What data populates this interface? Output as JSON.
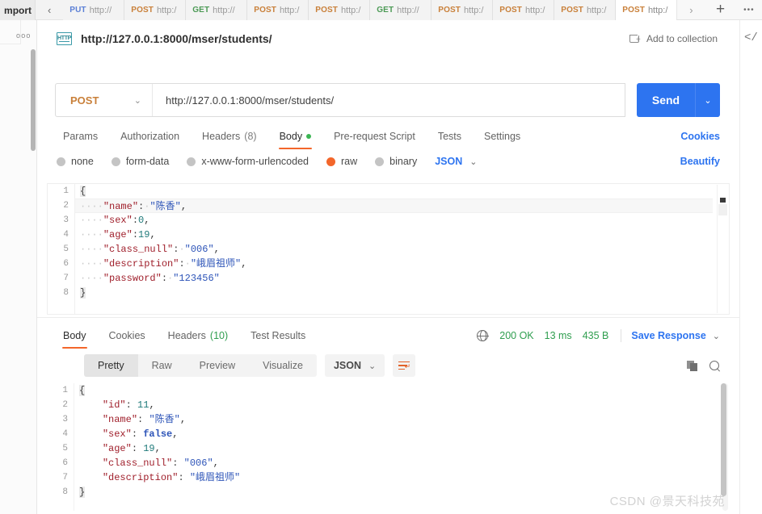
{
  "app": {
    "import_label": "mport",
    "watermark": "CSDN @景天科技苑"
  },
  "tabbar": {
    "left_chevron": "‹",
    "right_chevron": "›",
    "plus": "+",
    "dots": "•••",
    "tabs": [
      {
        "method": "PUT",
        "url": "http://",
        "active": false
      },
      {
        "method": "POST",
        "url": "http:/",
        "active": false
      },
      {
        "method": "GET",
        "url": "http://",
        "active": false
      },
      {
        "method": "POST",
        "url": "http:/",
        "active": false
      },
      {
        "method": "POST",
        "url": "http:/",
        "active": false
      },
      {
        "method": "GET",
        "url": "http://",
        "active": false
      },
      {
        "method": "POST",
        "url": "http:/",
        "active": false
      },
      {
        "method": "POST",
        "url": "http:/",
        "active": false
      },
      {
        "method": "POST",
        "url": "http:/",
        "active": false
      },
      {
        "method": "POST",
        "url": "http:/",
        "active": true
      }
    ]
  },
  "left_rail": {
    "dots": "ooo"
  },
  "right_rail": {
    "code_icon": "</"
  },
  "request_header": {
    "icon_label": "HTTP",
    "title": "http://127.0.0.1:8000/mser/students/",
    "add_to_collection": "Add to collection"
  },
  "urlbar": {
    "method": "POST",
    "method_caret": "⌄",
    "url": "http://127.0.0.1:8000/mser/students/",
    "send_label": "Send",
    "send_caret": "⌄"
  },
  "request_tabs": {
    "items": [
      {
        "label": "Params",
        "active": false
      },
      {
        "label": "Authorization",
        "active": false
      },
      {
        "label": "Headers",
        "count": "(8)",
        "active": false
      },
      {
        "label": "Body",
        "active": true,
        "dot": true
      },
      {
        "label": "Pre-request Script",
        "active": false
      },
      {
        "label": "Tests",
        "active": false
      },
      {
        "label": "Settings",
        "active": false
      }
    ],
    "cookies_link": "Cookies"
  },
  "body_types": {
    "options": [
      {
        "label": "none",
        "selected": false
      },
      {
        "label": "form-data",
        "selected": false
      },
      {
        "label": "x-www-form-urlencoded",
        "selected": false
      },
      {
        "label": "raw",
        "selected": true
      },
      {
        "label": "binary",
        "selected": false
      }
    ],
    "format": "JSON",
    "format_caret": "⌄",
    "beautify": "Beautify"
  },
  "request_body": {
    "line_numbers": [
      "1",
      "2",
      "3",
      "4",
      "5",
      "6",
      "7",
      "8"
    ],
    "lines": [
      {
        "indent": "",
        "tokens": [
          {
            "t": "brace",
            "v": "{"
          }
        ]
      },
      {
        "indent": "····",
        "tokens": [
          {
            "t": "k",
            "v": "\"name\""
          },
          {
            "t": "p",
            "v": ":"
          },
          {
            "t": "ws",
            "v": "·"
          },
          {
            "t": "s",
            "v": "\"陈香\""
          },
          {
            "t": "p",
            "v": ","
          }
        ],
        "highlight": true
      },
      {
        "indent": "····",
        "tokens": [
          {
            "t": "k",
            "v": "\"sex\""
          },
          {
            "t": "p",
            "v": ":"
          },
          {
            "t": "n",
            "v": "0"
          },
          {
            "t": "p",
            "v": ","
          }
        ]
      },
      {
        "indent": "····",
        "tokens": [
          {
            "t": "k",
            "v": "\"age\""
          },
          {
            "t": "p",
            "v": ":"
          },
          {
            "t": "n",
            "v": "19"
          },
          {
            "t": "p",
            "v": ","
          }
        ]
      },
      {
        "indent": "····",
        "tokens": [
          {
            "t": "k",
            "v": "\"class_null\""
          },
          {
            "t": "p",
            "v": ":"
          },
          {
            "t": "ws",
            "v": "·"
          },
          {
            "t": "s",
            "v": "\"006\""
          },
          {
            "t": "p",
            "v": ","
          }
        ]
      },
      {
        "indent": "····",
        "tokens": [
          {
            "t": "k",
            "v": "\"description\""
          },
          {
            "t": "p",
            "v": ":"
          },
          {
            "t": "ws",
            "v": "·"
          },
          {
            "t": "s",
            "v": "\"峨眉祖师\""
          },
          {
            "t": "p",
            "v": ","
          }
        ]
      },
      {
        "indent": "····",
        "tokens": [
          {
            "t": "k",
            "v": "\"password\""
          },
          {
            "t": "p",
            "v": ":"
          },
          {
            "t": "ws",
            "v": "·"
          },
          {
            "t": "s",
            "v": "\"123456\""
          }
        ]
      },
      {
        "indent": "",
        "tokens": [
          {
            "t": "brace",
            "v": "}"
          }
        ]
      }
    ]
  },
  "response_tabs": {
    "items": [
      {
        "label": "Body",
        "active": true
      },
      {
        "label": "Cookies",
        "active": false
      },
      {
        "label": "Headers",
        "count": "(10)",
        "active": false
      },
      {
        "label": "Test Results",
        "active": false
      }
    ]
  },
  "response_meta": {
    "status": "200 OK",
    "time": "13 ms",
    "size": "435 B",
    "save_response": "Save Response",
    "save_caret": "⌄"
  },
  "response_toolbar": {
    "formats": [
      {
        "label": "Pretty",
        "active": true
      },
      {
        "label": "Raw",
        "active": false
      },
      {
        "label": "Preview",
        "active": false
      },
      {
        "label": "Visualize",
        "active": false
      }
    ],
    "type": "JSON",
    "type_caret": "⌄"
  },
  "response_body": {
    "line_numbers": [
      "1",
      "2",
      "3",
      "4",
      "5",
      "6",
      "7",
      "8"
    ],
    "lines": [
      {
        "indent": "",
        "tokens": [
          {
            "t": "brace",
            "v": "{"
          }
        ]
      },
      {
        "indent": "    ",
        "tokens": [
          {
            "t": "k",
            "v": "\"id\""
          },
          {
            "t": "p",
            "v": ": "
          },
          {
            "t": "n",
            "v": "11"
          },
          {
            "t": "p",
            "v": ","
          }
        ]
      },
      {
        "indent": "    ",
        "tokens": [
          {
            "t": "k",
            "v": "\"name\""
          },
          {
            "t": "p",
            "v": ": "
          },
          {
            "t": "s",
            "v": "\"陈香\""
          },
          {
            "t": "p",
            "v": ","
          }
        ]
      },
      {
        "indent": "    ",
        "tokens": [
          {
            "t": "k",
            "v": "\"sex\""
          },
          {
            "t": "p",
            "v": ": "
          },
          {
            "t": "b",
            "v": "false"
          },
          {
            "t": "p",
            "v": ","
          }
        ]
      },
      {
        "indent": "    ",
        "tokens": [
          {
            "t": "k",
            "v": "\"age\""
          },
          {
            "t": "p",
            "v": ": "
          },
          {
            "t": "n",
            "v": "19"
          },
          {
            "t": "p",
            "v": ","
          }
        ]
      },
      {
        "indent": "    ",
        "tokens": [
          {
            "t": "k",
            "v": "\"class_null\""
          },
          {
            "t": "p",
            "v": ": "
          },
          {
            "t": "s",
            "v": "\"006\""
          },
          {
            "t": "p",
            "v": ","
          }
        ]
      },
      {
        "indent": "    ",
        "tokens": [
          {
            "t": "k",
            "v": "\"description\""
          },
          {
            "t": "p",
            "v": ": "
          },
          {
            "t": "s",
            "v": "\"峨眉祖师\""
          }
        ]
      },
      {
        "indent": "",
        "tokens": [
          {
            "t": "brace",
            "v": "}"
          }
        ]
      }
    ]
  },
  "colors": {
    "accent_orange": "#f3662a",
    "link_blue": "#2d74f0",
    "status_green": "#2f9e4f",
    "method_post": "#c9803a",
    "method_get": "#4c9a55",
    "method_put": "#5a7fd6",
    "json_key": "#a0202c",
    "json_string": "#2d54b8",
    "json_number": "#1f7a7a"
  }
}
